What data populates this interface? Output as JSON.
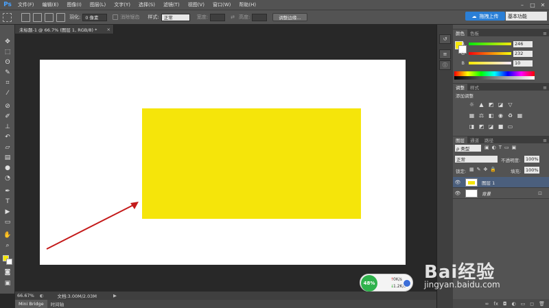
{
  "app": {
    "logo": "Ps"
  },
  "menu": {
    "items": [
      "文件(F)",
      "编辑(E)",
      "图像(I)",
      "图层(L)",
      "文字(Y)",
      "选择(S)",
      "滤镜(T)",
      "视图(V)",
      "窗口(W)",
      "帮助(H)"
    ]
  },
  "window_controls": {
    "minimize": "–",
    "maximize": "□",
    "close": "✕"
  },
  "options": {
    "feather_label": "羽化:",
    "feather_value": "0 像素",
    "antialias_label": "消除锯齿",
    "style_label": "样式:",
    "style_value": "正常",
    "width_label": "宽度:",
    "height_label": "高度:",
    "refine_edge_label": "调整边缘..."
  },
  "upload": {
    "label": "拖拽上传"
  },
  "workspace": {
    "value": "基本功能"
  },
  "document": {
    "tab_title": "未标题-1 @ 66.7% (图层 1, RGB/8) *",
    "close": "×"
  },
  "status": {
    "zoom": "66.67%",
    "doc_size": "文档:3.00M/2.03M"
  },
  "bottom_tabs": [
    "Mini Bridge",
    "时间轴"
  ],
  "net": {
    "percent": "48%",
    "up": "0K/s",
    "down": "1.2K/s"
  },
  "color_panel": {
    "tabs": [
      "颜色",
      "色板"
    ],
    "r": {
      "label": "R",
      "value": "246"
    },
    "g": {
      "label": "G",
      "value": "232"
    },
    "b": {
      "label": "B",
      "value": "10"
    },
    "fg_color": "#f6e80a"
  },
  "adjust_panel": {
    "tabs": [
      "调整",
      "样式"
    ],
    "title": "添加调整"
  },
  "layers_panel": {
    "tabs": [
      "图层",
      "通道",
      "路径"
    ],
    "filter_label": "ρ 类型",
    "blend_mode": "正常",
    "opacity_label": "不透明度:",
    "opacity_value": "100%",
    "lock_label": "锁定:",
    "fill_label": "填充:",
    "fill_value": "100%",
    "layers": [
      {
        "name": "图层 1"
      },
      {
        "name": "背景"
      }
    ]
  },
  "watermark": {
    "brand": "Bai经验",
    "url": "jingyan.baidu.com"
  }
}
